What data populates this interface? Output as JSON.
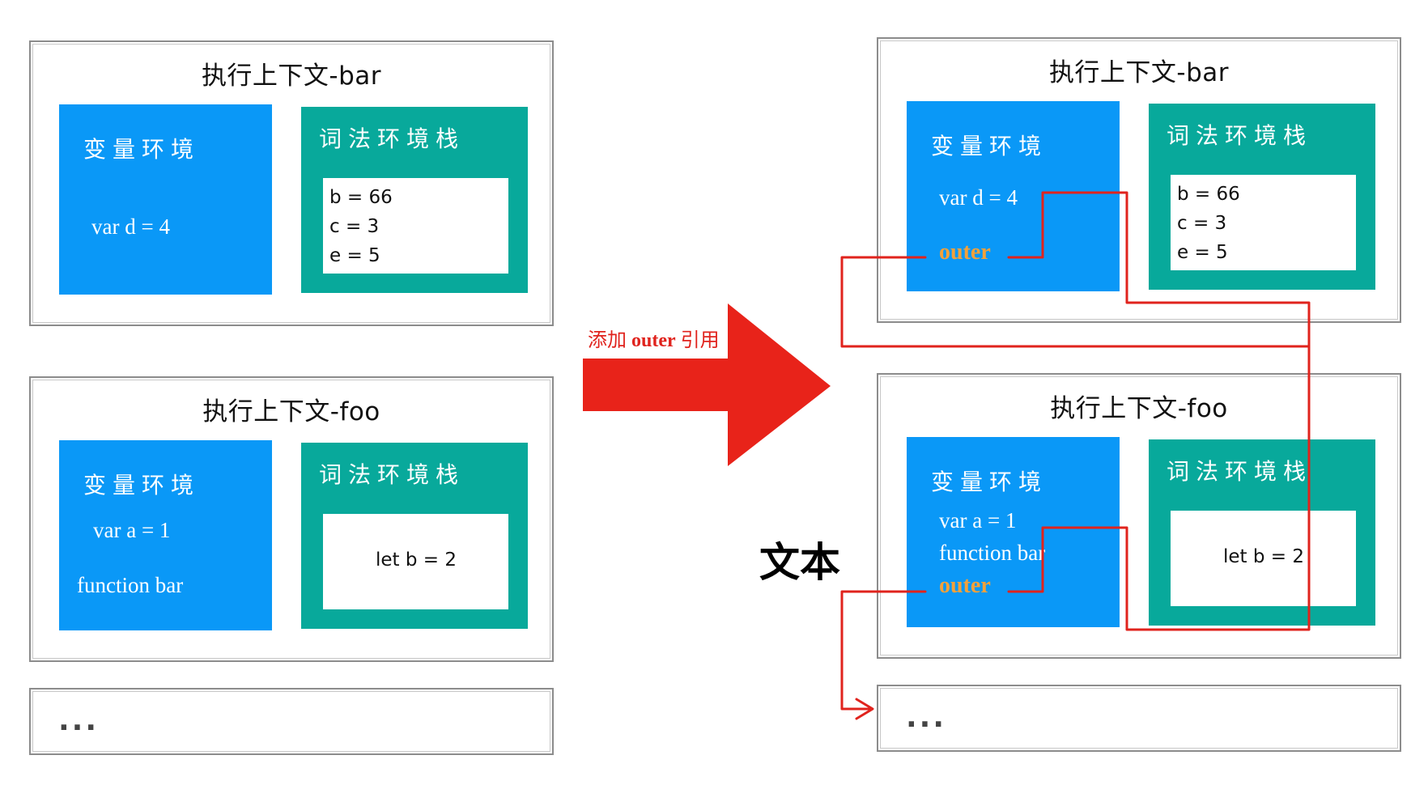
{
  "left": {
    "bar": {
      "title": "执行上下文-bar",
      "var_env_label": "变量环境",
      "var_lines": [
        "var d = 4"
      ],
      "lex_env_label": "词法环境栈",
      "lex_lines": [
        "b = 66",
        "c = 3",
        "e = 5"
      ]
    },
    "foo": {
      "title": "执行上下文-foo",
      "var_env_label": "变量环境",
      "var_lines": [
        "var a = 1",
        "function bar"
      ],
      "lex_env_label": "词法环境栈",
      "lex_lines": [
        "let b = 2"
      ]
    },
    "rest": "..."
  },
  "arrow": {
    "label_pre": "添加 ",
    "label_strong": "outer",
    "label_post": " 引用"
  },
  "free_text": "文本",
  "right": {
    "bar": {
      "title": "执行上下文-bar",
      "var_env_label": "变量环境",
      "var_lines": [
        "var d = 4"
      ],
      "outer_label": "outer",
      "lex_env_label": "词法环境栈",
      "lex_lines": [
        "b = 66",
        "c = 3",
        "e = 5"
      ]
    },
    "foo": {
      "title": "执行上下文-foo",
      "var_env_label": "变量环境",
      "var_lines": [
        "var a = 1",
        "function bar"
      ],
      "outer_label": "outer",
      "lex_env_label": "词法环境栈",
      "lex_lines": [
        "let b = 2"
      ]
    },
    "rest": "..."
  },
  "colors": {
    "variable_environment": "#0a98f7",
    "lexical_environment": "#08a99b",
    "outer_keyword": "#f3a13a",
    "arrow": "#e8231a",
    "reference_line": "#e0231d"
  }
}
